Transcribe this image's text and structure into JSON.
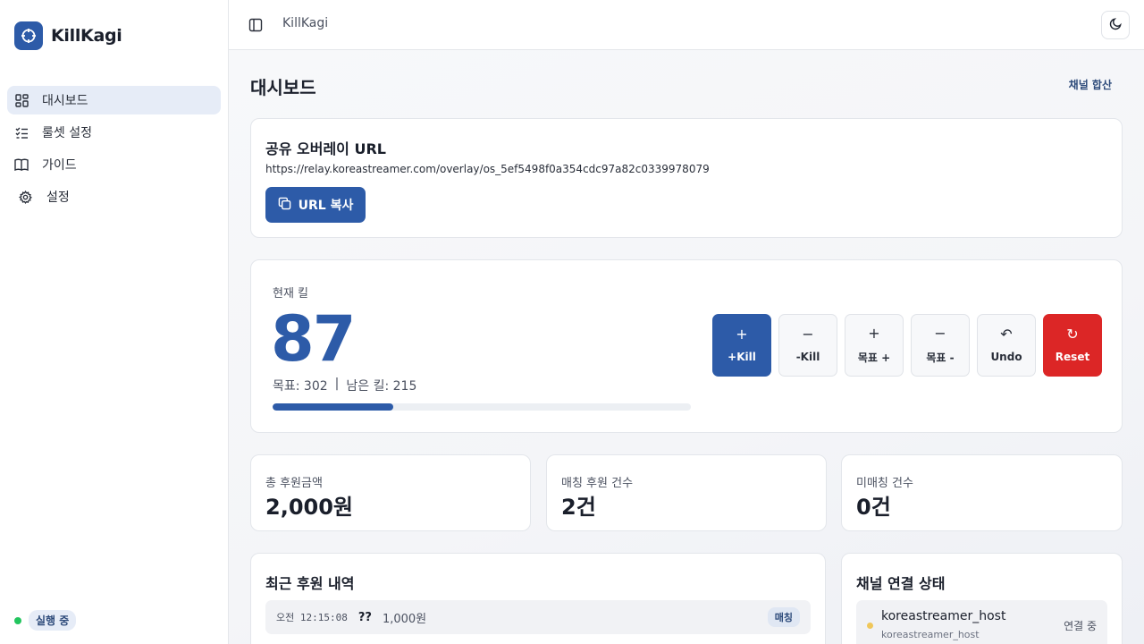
{
  "app": {
    "name": "KillKagi"
  },
  "sidebar": {
    "items": [
      {
        "label": "대시보드",
        "icon": "dashboard-icon",
        "active": true
      },
      {
        "label": "룰셋 설정",
        "icon": "checklist-icon",
        "active": false
      },
      {
        "label": "가이드",
        "icon": "book-icon",
        "active": false
      },
      {
        "label": "설정",
        "icon": "gear-icon",
        "active": false
      }
    ],
    "status": {
      "label": "실행 중",
      "color": "#22c55e"
    }
  },
  "topbar": {
    "title": "KillKagi"
  },
  "page": {
    "title": "대시보드",
    "merge_link": "채널 합산"
  },
  "overlay": {
    "title": "공유 오버레이 URL",
    "url": "https://relay.koreastreamer.com/overlay/os_5ef5498f0a354cdc97a82c0339978079",
    "copy_label": "URL 복사"
  },
  "kill": {
    "label": "현재 킬",
    "value": "87",
    "target_text": "목표: 302",
    "separator": "|",
    "remaining_text": "남은 킬: 215",
    "progress_fraction": 0.288,
    "actions": [
      {
        "glyph": "+",
        "label": "+Kill",
        "style": "primary",
        "icon": "plus-icon"
      },
      {
        "glyph": "−",
        "label": "-Kill",
        "style": "default",
        "icon": "minus-icon"
      },
      {
        "glyph": "+",
        "label": "목표 +",
        "style": "default",
        "icon": "plus-icon"
      },
      {
        "glyph": "−",
        "label": "목표 -",
        "style": "default",
        "icon": "minus-icon"
      },
      {
        "glyph": "↶",
        "label": "Undo",
        "style": "default",
        "icon": "undo-icon"
      },
      {
        "glyph": "↻",
        "label": "Reset",
        "style": "danger",
        "icon": "reset-icon"
      }
    ]
  },
  "stats": [
    {
      "label": "총 후원금액",
      "value": "2,000원"
    },
    {
      "label": "매칭 후원 건수",
      "value": "2건"
    },
    {
      "label": "미매칭 건수",
      "value": "0건"
    }
  ],
  "recent": {
    "title": "최근 후원 내역",
    "rows": [
      {
        "time": "오전 12:15:08",
        "name": "??",
        "amount": "1,000원",
        "badge": "매칭"
      }
    ]
  },
  "channels": {
    "title": "채널 연결 상태",
    "rows": [
      {
        "name": "koreastreamer_host",
        "sub": "koreastreamer_host",
        "state": "연결 중"
      }
    ]
  },
  "colors": {
    "accent": "#2d5ba8",
    "danger": "#dc2626",
    "pending": "#f0c75a"
  }
}
